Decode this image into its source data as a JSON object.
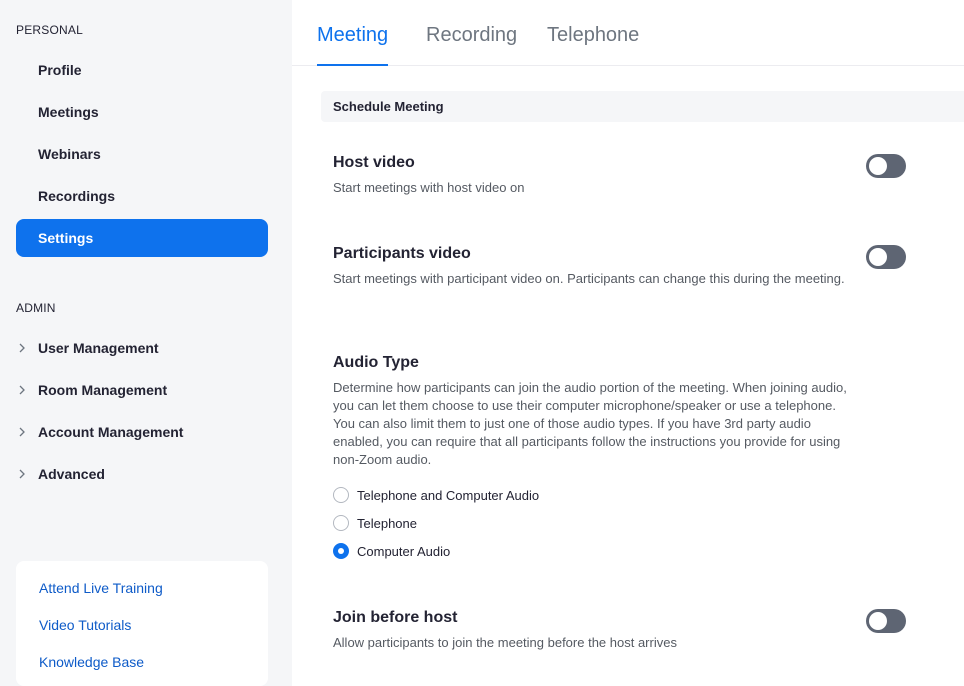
{
  "sidebar": {
    "personal_title": "PERSONAL",
    "personal_items": [
      "Profile",
      "Meetings",
      "Webinars",
      "Recordings",
      "Settings"
    ],
    "active_item": "Settings",
    "admin_title": "ADMIN",
    "admin_items": [
      "User Management",
      "Room Management",
      "Account Management",
      "Advanced"
    ],
    "help_links": [
      "Attend Live Training",
      "Video Tutorials",
      "Knowledge Base"
    ]
  },
  "tabs": {
    "items": [
      "Meeting",
      "Recording",
      "Telephone"
    ],
    "active": "Meeting"
  },
  "section": {
    "title": "Schedule Meeting"
  },
  "settings": {
    "host_video": {
      "title": "Host video",
      "desc": "Start meetings with host video on",
      "enabled": false
    },
    "participants_video": {
      "title": "Participants video",
      "desc": "Start meetings with participant video on. Participants can change this during the meeting.",
      "enabled": false
    },
    "audio_type": {
      "title": "Audio Type",
      "desc": "Determine how participants can join the audio portion of the meeting. When joining audio, you can let them choose to use their computer microphone/speaker or use a telephone. You can also limit them to just one of those audio types. If you have 3rd party audio enabled, you can require that all participants follow the instructions you provide for using non-Zoom audio.",
      "options": [
        "Telephone and Computer Audio",
        "Telephone",
        "Computer Audio"
      ],
      "selected": "Computer Audio"
    },
    "join_before_host": {
      "title": "Join before host",
      "desc": "Allow participants to join the meeting before the host arrives",
      "enabled": false
    }
  },
  "colors": {
    "accent": "#0e72ed",
    "toggle_off": "#5e6573",
    "sidebar_bg": "#f5f6f8"
  }
}
